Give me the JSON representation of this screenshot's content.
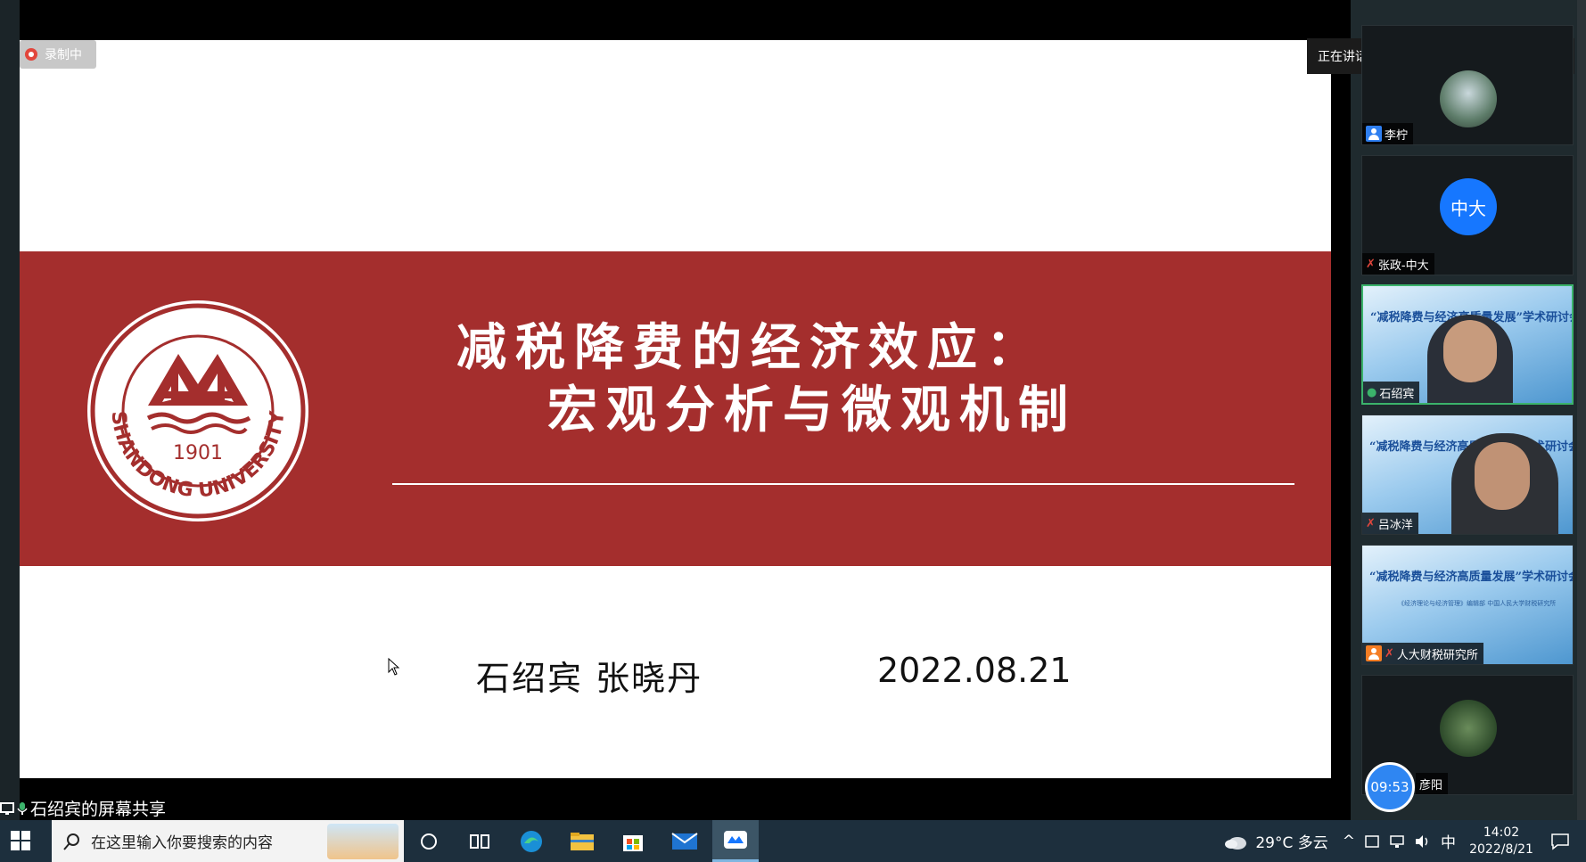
{
  "recording": {
    "label": "录制中"
  },
  "slide": {
    "title_line1": "减税降费的经济效应：",
    "title_line2": "宏观分析与微观机制",
    "authors": "石绍宾  张晓丹",
    "date": "2022.08.21",
    "logo": {
      "year": "1901",
      "name": "SHANDONG UNIVERSITY"
    }
  },
  "share_label": "石绍宾的屏幕共享",
  "speaking": {
    "label": "正在讲话: 石绍宾;"
  },
  "participants": [
    {
      "name": "李柠"
    },
    {
      "name": "张政-中大",
      "avatar_text": "中大"
    },
    {
      "name": "石绍宾",
      "banner": "“减税降费与经济高质量发展”学术研讨会"
    },
    {
      "name": "吕冰洋",
      "banner": "“减税降费与经济高质量发展”学术研讨会"
    },
    {
      "name": "人大财税研究所",
      "banner": "“减税降费与经济高质量发展”学术研讨会",
      "banner_sub": "《经济理论与经济管理》编辑部 中国人民大学财税研究所"
    },
    {
      "name": "彦阳"
    }
  ],
  "timer": "09:53",
  "taskbar": {
    "search_placeholder": "在这里输入你要搜索的内容",
    "weather": "29°C 多云",
    "ime": "中",
    "time": "14:02",
    "date": "2022/8/21"
  }
}
